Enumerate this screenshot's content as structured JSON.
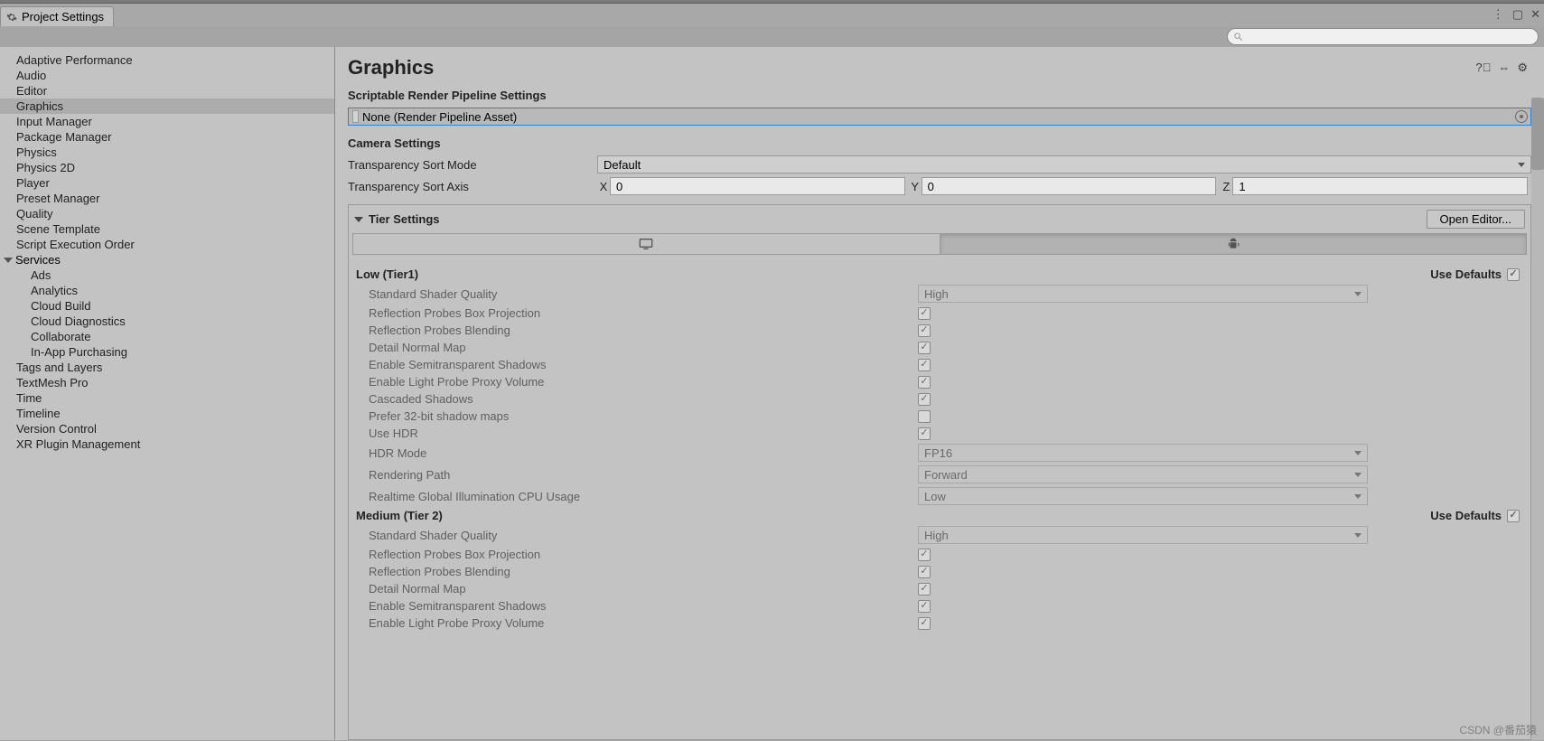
{
  "tab": {
    "title": "Project Settings"
  },
  "search": {
    "placeholder": ""
  },
  "sidebar": {
    "items": [
      {
        "label": "Adaptive Performance"
      },
      {
        "label": "Audio"
      },
      {
        "label": "Editor"
      },
      {
        "label": "Graphics",
        "selected": true
      },
      {
        "label": "Input Manager"
      },
      {
        "label": "Package Manager"
      },
      {
        "label": "Physics"
      },
      {
        "label": "Physics 2D"
      },
      {
        "label": "Player"
      },
      {
        "label": "Preset Manager"
      },
      {
        "label": "Quality"
      },
      {
        "label": "Scene Template"
      },
      {
        "label": "Script Execution Order"
      }
    ],
    "services_label": "Services",
    "services": [
      {
        "label": "Ads"
      },
      {
        "label": "Analytics"
      },
      {
        "label": "Cloud Build"
      },
      {
        "label": "Cloud Diagnostics"
      },
      {
        "label": "Collaborate"
      },
      {
        "label": "In-App Purchasing"
      }
    ],
    "tail": [
      {
        "label": "Tags and Layers"
      },
      {
        "label": "TextMesh Pro"
      },
      {
        "label": "Time"
      },
      {
        "label": "Timeline"
      },
      {
        "label": "Version Control"
      },
      {
        "label": "XR Plugin Management"
      }
    ]
  },
  "page": {
    "title": "Graphics",
    "srp_heading": "Scriptable Render Pipeline Settings",
    "srp_value": "None (Render Pipeline Asset)",
    "camera_heading": "Camera Settings",
    "transparency_sort_mode_label": "Transparency Sort Mode",
    "transparency_sort_mode_value": "Default",
    "transparency_sort_axis_label": "Transparency Sort Axis",
    "axis": {
      "x_label": "X",
      "x": "0",
      "y_label": "Y",
      "y": "0",
      "z_label": "Z",
      "z": "1"
    },
    "tier": {
      "heading": "Tier Settings",
      "open_editor": "Open Editor...",
      "use_defaults_label": "Use Defaults",
      "tiers": [
        {
          "name": "Low (Tier1)",
          "use_defaults": true,
          "props": [
            {
              "label": "Standard Shader Quality",
              "type": "dropdown",
              "value": "High"
            },
            {
              "label": "Reflection Probes Box Projection",
              "type": "check",
              "value": true
            },
            {
              "label": "Reflection Probes Blending",
              "type": "check",
              "value": true
            },
            {
              "label": "Detail Normal Map",
              "type": "check",
              "value": true
            },
            {
              "label": "Enable Semitransparent Shadows",
              "type": "check",
              "value": true
            },
            {
              "label": "Enable Light Probe Proxy Volume",
              "type": "check",
              "value": true
            },
            {
              "label": "Cascaded Shadows",
              "type": "check",
              "value": true
            },
            {
              "label": "Prefer 32-bit shadow maps",
              "type": "check",
              "value": false
            },
            {
              "label": "Use HDR",
              "type": "check",
              "value": true
            },
            {
              "label": "HDR Mode",
              "type": "dropdown",
              "value": "FP16"
            },
            {
              "label": "Rendering Path",
              "type": "dropdown",
              "value": "Forward"
            },
            {
              "label": "Realtime Global Illumination CPU Usage",
              "type": "dropdown",
              "value": "Low"
            }
          ]
        },
        {
          "name": "Medium (Tier 2)",
          "use_defaults": true,
          "props": [
            {
              "label": "Standard Shader Quality",
              "type": "dropdown",
              "value": "High"
            },
            {
              "label": "Reflection Probes Box Projection",
              "type": "check",
              "value": true
            },
            {
              "label": "Reflection Probes Blending",
              "type": "check",
              "value": true
            },
            {
              "label": "Detail Normal Map",
              "type": "check",
              "value": true
            },
            {
              "label": "Enable Semitransparent Shadows",
              "type": "check",
              "value": true
            },
            {
              "label": "Enable Light Probe Proxy Volume",
              "type": "check",
              "value": true
            }
          ]
        }
      ]
    }
  },
  "watermark": "CSDN @番茄猿"
}
